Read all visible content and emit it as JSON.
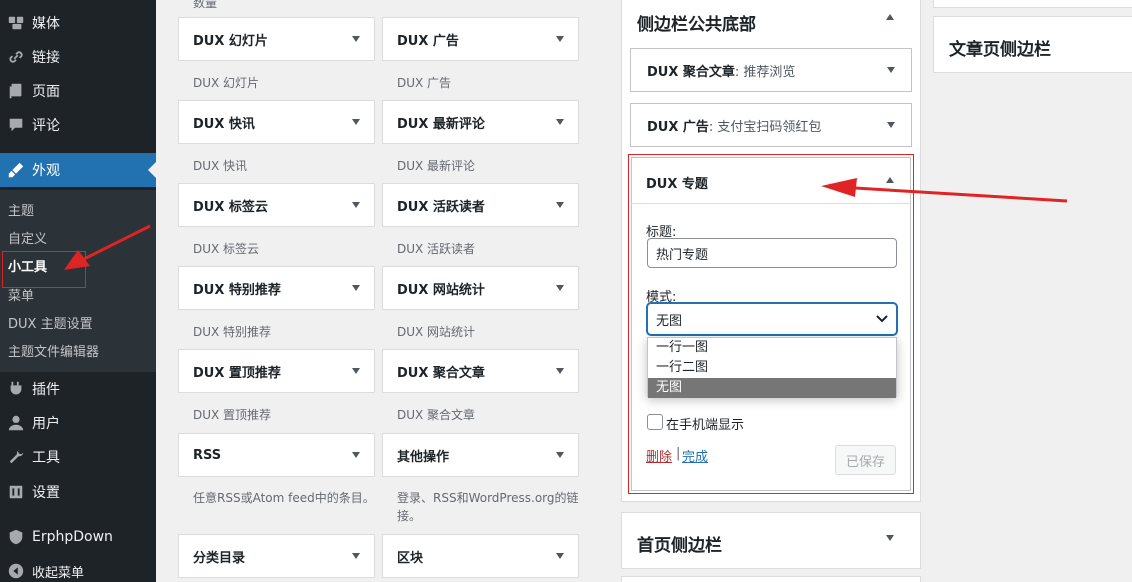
{
  "admin_menu": {
    "items": [
      {
        "label": "媒体",
        "icon": "media-icon"
      },
      {
        "label": "链接",
        "icon": "links-icon"
      },
      {
        "label": "页面",
        "icon": "pages-icon"
      },
      {
        "label": "评论",
        "icon": "comments-icon"
      },
      {
        "label": "外观",
        "icon": "appearance-icon"
      },
      {
        "label": "插件",
        "icon": "plugins-icon"
      },
      {
        "label": "用户",
        "icon": "users-icon"
      },
      {
        "label": "工具",
        "icon": "tools-icon"
      },
      {
        "label": "设置",
        "icon": "settings-icon"
      },
      {
        "label": "ErphpDown",
        "icon": "shield-icon"
      },
      {
        "label": "收起菜单",
        "icon": "collapse-icon"
      }
    ],
    "submenu": [
      "主题",
      "自定义",
      "小工具",
      "菜单",
      "DUX 主题设置",
      "主题文件编辑器"
    ]
  },
  "widgets": {
    "top_cut_text": "数量",
    "list": [
      {
        "title": "DUX 幻灯片",
        "desc": "DUX 幻灯片"
      },
      {
        "title": "DUX 广告",
        "desc": "DUX 广告"
      },
      {
        "title": "DUX 快讯",
        "desc": "DUX 快讯"
      },
      {
        "title": "DUX 最新评论",
        "desc": "DUX 最新评论"
      },
      {
        "title": "DUX 标签云",
        "desc": "DUX 标签云"
      },
      {
        "title": "DUX 活跃读者",
        "desc": "DUX 活跃读者"
      },
      {
        "title": "DUX 特别推荐",
        "desc": "DUX 特别推荐"
      },
      {
        "title": "DUX 网站统计",
        "desc": "DUX 网站统计"
      },
      {
        "title": "DUX 置顶推荐",
        "desc": "DUX 置顶推荐"
      },
      {
        "title": "DUX 聚合文章",
        "desc": "DUX 聚合文章"
      },
      {
        "title": "RSS",
        "desc": "任意RSS或Atom feed中的条目。"
      },
      {
        "title": "其他操作",
        "desc": "登录、RSS和WordPress.org的链接。"
      },
      {
        "title": "分类目录",
        "desc": ""
      },
      {
        "title": "区块",
        "desc": ""
      }
    ]
  },
  "sidebar_footer": {
    "title": "侧边栏公共底部",
    "sub_widgets": [
      {
        "name": "DUX 聚合文章",
        "detail": ": 推荐浏览"
      },
      {
        "name": "DUX 广告",
        "detail": ": 支付宝扫码领红包"
      }
    ],
    "open_widget": {
      "name": "DUX 专题",
      "title_label": "标题:",
      "title_value": "热门专题",
      "mode_label": "模式:",
      "mode_value": "无图",
      "mode_options": [
        "一行一图",
        "一行二图",
        "无图"
      ],
      "mobile_label": "在手机端显示",
      "delete_label": "删除",
      "separator": "|",
      "done_label": "完成",
      "saved_label": "已保存"
    }
  },
  "home_sidebar": {
    "title": "首页侧边栏"
  },
  "article_sidebar": {
    "title": "文章页侧边栏"
  },
  "colors": {
    "accent": "#2271b1",
    "annotation": "#e02424",
    "admin_bg": "#1d2327"
  }
}
